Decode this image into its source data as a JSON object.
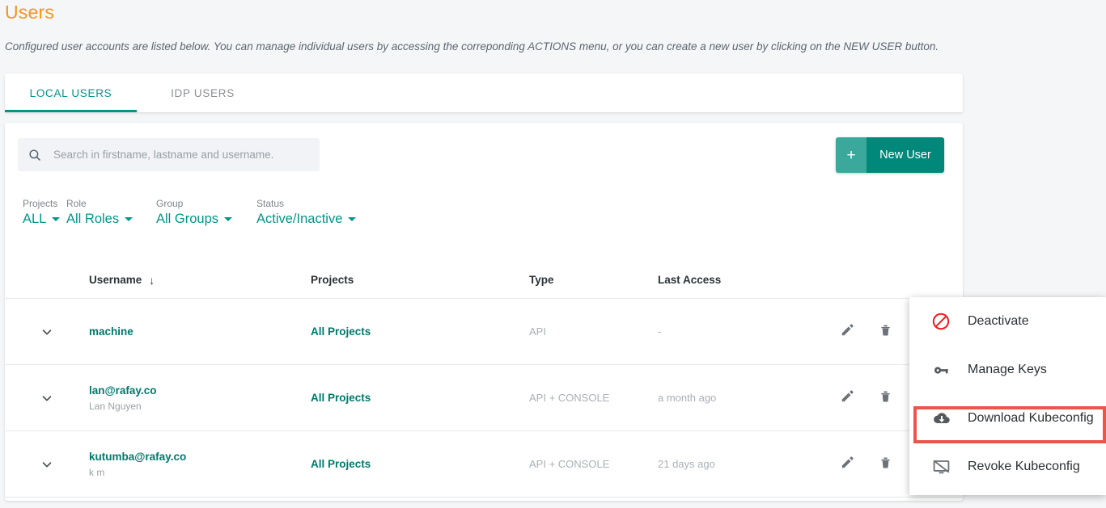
{
  "header": {
    "title": "Users",
    "description": "Configured user accounts are listed below. You can manage individual users by accessing the correponding ACTIONS menu, or you can create a new user by clicking on the NEW USER button."
  },
  "tabs": [
    {
      "label": "LOCAL USERS",
      "active": true
    },
    {
      "label": "IDP USERS",
      "active": false
    }
  ],
  "search": {
    "placeholder": "Search in firstname, lastname and username.",
    "value": "",
    "icon": "search-icon"
  },
  "new_user_button": {
    "plus": "+",
    "label": "New User"
  },
  "filters": [
    {
      "label": "Projects",
      "value": "ALL"
    },
    {
      "label": "Role",
      "value": "All Roles"
    },
    {
      "label": "Group",
      "value": "All Groups"
    },
    {
      "label": "Status",
      "value": "Active/Inactive"
    }
  ],
  "table": {
    "columns": {
      "username": "Username",
      "sort_indicator": "↓",
      "projects": "Projects",
      "type": "Type",
      "last_access": "Last Access"
    },
    "rows": [
      {
        "expand_icon": "chevron-down-icon",
        "username": "machine",
        "fullname": "",
        "projects": "All Projects",
        "type": "API",
        "last_access": "-"
      },
      {
        "expand_icon": "chevron-down-icon",
        "username": "lan@rafay.co",
        "fullname": "Lan Nguyen",
        "projects": "All Projects",
        "type": "API + CONSOLE",
        "last_access": "a month ago"
      },
      {
        "expand_icon": "chevron-down-icon",
        "username": "kutumba@rafay.co",
        "fullname": "k m",
        "projects": "All Projects",
        "type": "API + CONSOLE",
        "last_access": "21 days ago"
      }
    ]
  },
  "actions_menu": {
    "items": [
      {
        "label": "Deactivate",
        "icon": "block-icon",
        "highlighted": false
      },
      {
        "label": "Manage Keys",
        "icon": "key-icon",
        "highlighted": false
      },
      {
        "label": "Download Kubeconfig",
        "icon": "cloud-download-icon",
        "highlighted": true
      },
      {
        "label": "Revoke Kubeconfig",
        "icon": "monitor-off-icon",
        "highlighted": false
      }
    ]
  },
  "colors": {
    "title": "#f7941e",
    "accent_teal": "#009688",
    "button_teal": "#00887a",
    "highlight_red": "#e8584a",
    "page_bg": "#f4f6f8"
  }
}
